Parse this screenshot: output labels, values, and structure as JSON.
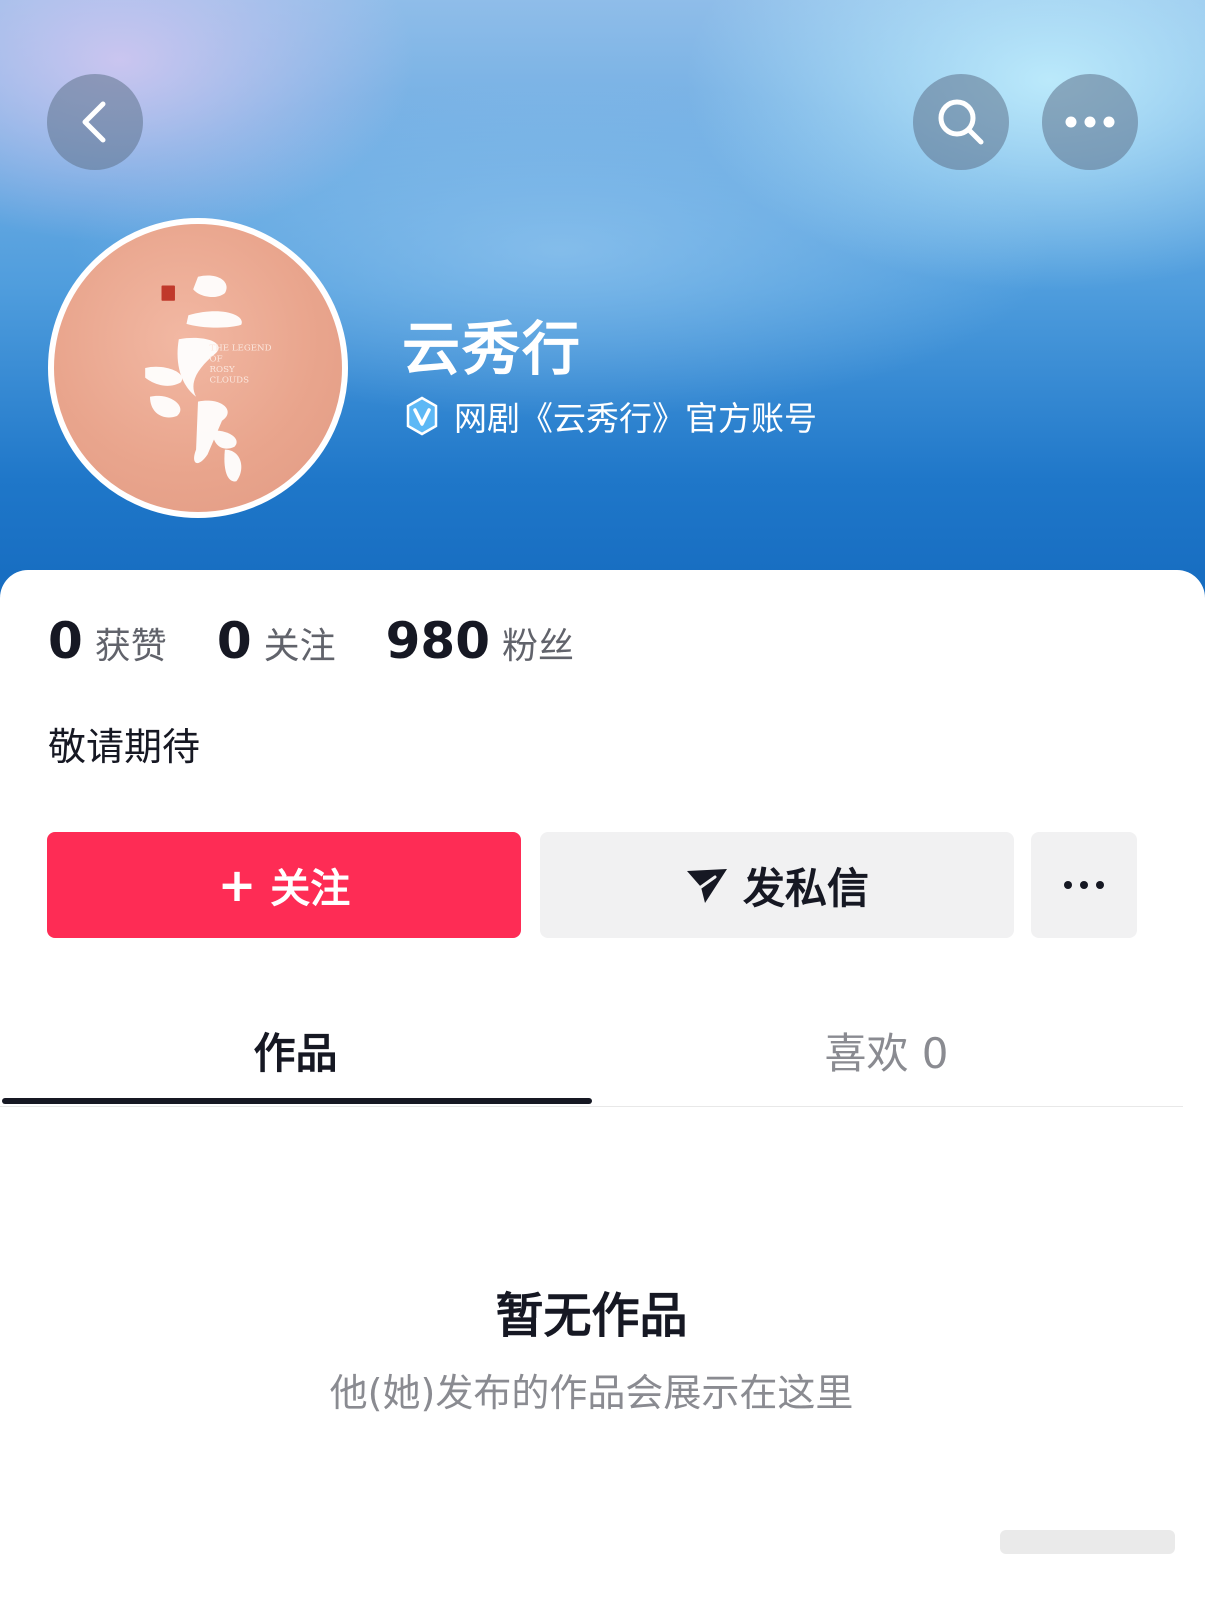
{
  "nav": {
    "back_icon": "chevron-left-icon",
    "search_icon": "search-icon",
    "more_icon": "more-horizontal-icon"
  },
  "profile": {
    "name": "云秀行",
    "verify_text": "网剧《云秀行》官方账号",
    "verify_icon": "verified-v-icon",
    "avatar": {
      "calligraphy": "云秀行",
      "english_title": [
        "THE LEGEND",
        "OF",
        "ROSY",
        "CLOUDS"
      ]
    },
    "bio": "敬请期待"
  },
  "stats": [
    {
      "value": "0",
      "label": "获赞"
    },
    {
      "value": "0",
      "label": "关注"
    },
    {
      "value": "980",
      "label": "粉丝"
    }
  ],
  "actions": {
    "follow_plus": "+",
    "follow_label": "关注",
    "message_label": "发私信",
    "message_icon": "send-icon",
    "more_icon": "more-horizontal-icon"
  },
  "tabs": [
    {
      "label": "作品",
      "active": true
    },
    {
      "label": "喜欢 0",
      "active": false
    }
  ],
  "empty_state": {
    "title": "暂无作品",
    "subtitle": "他(她)发布的作品会展示在这里"
  },
  "colors": {
    "accent": "#fe2c55",
    "header_blue": "#1f77c9",
    "text_primary": "#161823",
    "text_secondary": "#8a8b91"
  }
}
